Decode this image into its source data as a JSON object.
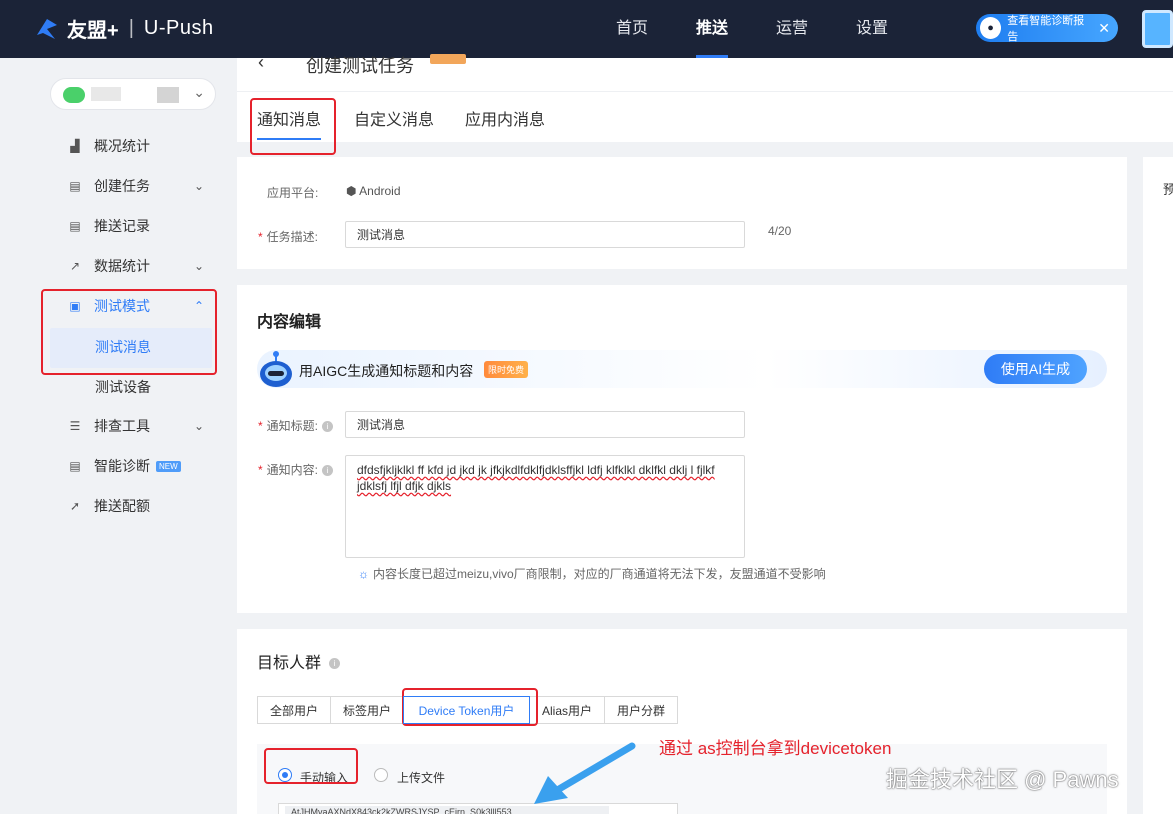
{
  "topbar": {
    "logo_brand": "友盟+",
    "logo_sep": "|",
    "logo_product": "U-Push",
    "nav": [
      "首页",
      "推送",
      "运营",
      "设置"
    ],
    "active_nav": "推送",
    "diag_button": "查看智能诊断报告",
    "diag_close": "✕"
  },
  "sidebar": {
    "items": [
      {
        "label": "概况统计",
        "icon": "chart-icon"
      },
      {
        "label": "创建任务",
        "icon": "doc-icon"
      },
      {
        "label": "推送记录",
        "icon": "record-icon"
      },
      {
        "label": "数据统计",
        "icon": "line-chart-icon"
      },
      {
        "label": "测试模式",
        "icon": "monitor-icon"
      },
      {
        "label": "测试消息"
      },
      {
        "label": "测试设备"
      },
      {
        "label": "排查工具",
        "icon": "list-icon"
      },
      {
        "label": "智能诊断",
        "icon": "diagnose-icon",
        "badge": "NEW"
      },
      {
        "label": "推送配额",
        "icon": "quota-icon"
      }
    ]
  },
  "page": {
    "back": "‹",
    "title": "创建测试任务",
    "tabs": [
      "通知消息",
      "自定义消息",
      "应用内消息"
    ],
    "right_panel_char": "预"
  },
  "basic": {
    "platform_label": "应用平台:",
    "platform_value": "Android",
    "desc_label": "任务描述:",
    "desc_value": "测试消息",
    "desc_count": "4/20"
  },
  "content": {
    "section_title": "内容编辑",
    "ai_text": "用AIGC生成通知标题和内容",
    "ai_badge": "限时免费",
    "ai_button": "使用AI生成",
    "title_label": "通知标题:",
    "title_value": "测试消息",
    "body_label": "通知内容:",
    "body_value": "dfdsfjkljklkl ff kfd jd jkd jk  jfkjkdlfdklfjdklsffjkl ldfj klfklkl dklfkl dklj l fjlkf jdklsfj lfjl dfjk djkls",
    "hint": "内容长度已超过meizu,vivo厂商限制，对应的厂商通道将无法下发，友盟通道不受影响"
  },
  "target": {
    "section_title": "目标人群",
    "segments": [
      "全部用户",
      "标签用户",
      "Device Token用户",
      "Alias用户",
      "用户分群"
    ],
    "active_segment": "Device Token用户",
    "radio_manual": "手动输入",
    "radio_upload": "上传文件",
    "token_preview": "AtJHMvaAXNdX843ck2kZWRSJYSP_cEirn_S0k3lll553"
  },
  "annotation": {
    "text": "通过 as控制台拿到devicetoken",
    "watermark": "掘金技术社区 @ Pawns"
  },
  "colors": {
    "accent": "#2f7cf6",
    "topbar_bg": "#1b2337",
    "highlight_red": "#e5222c"
  }
}
